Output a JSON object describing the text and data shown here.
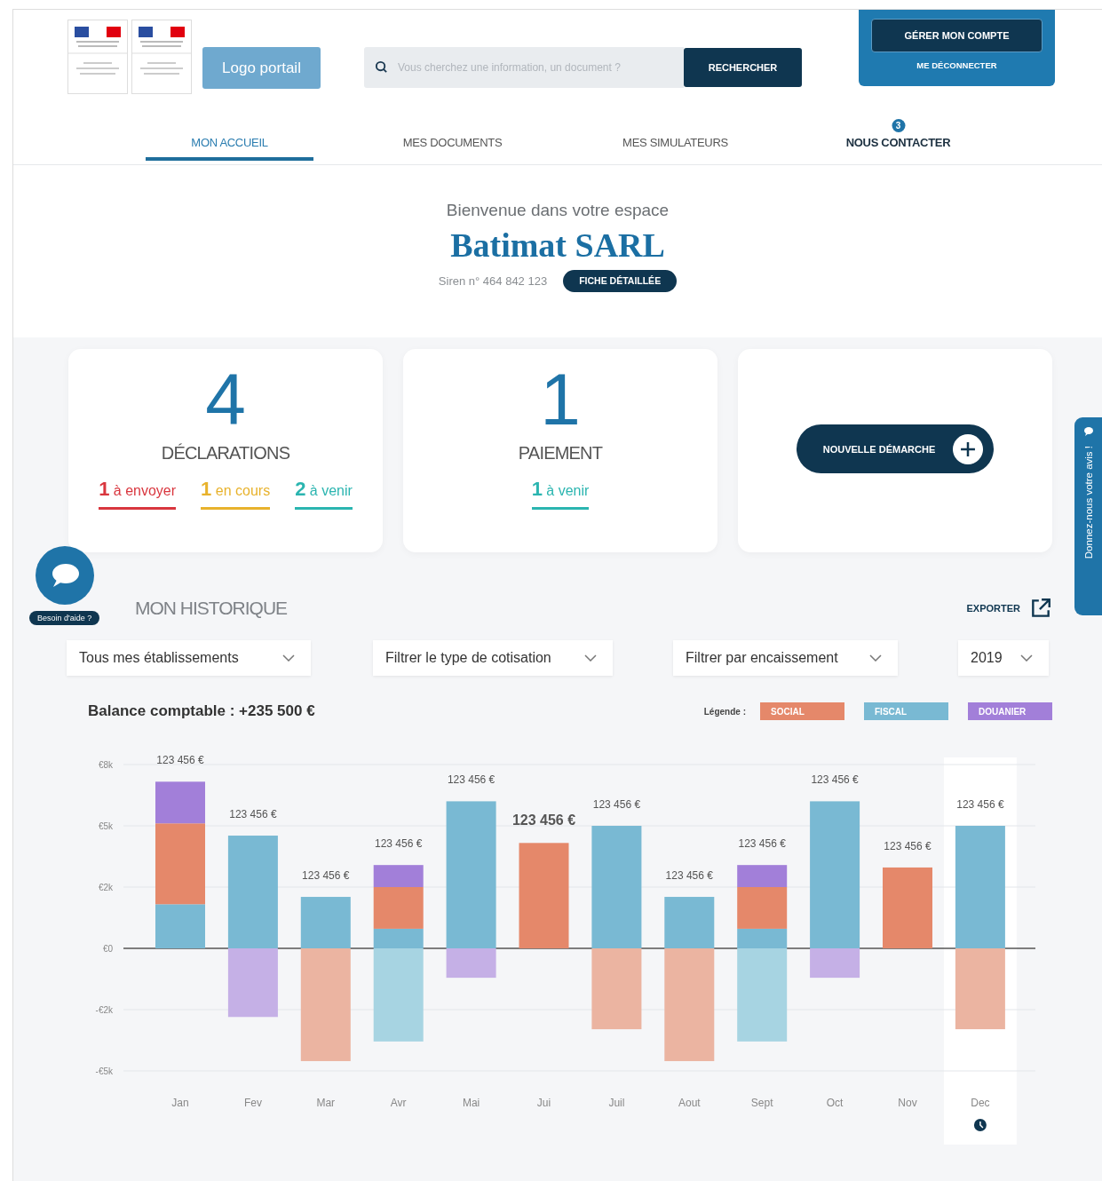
{
  "header": {
    "logo_button": "Logo portail",
    "search": {
      "placeholder": "Vous cherchez une information, un document ?",
      "button": "RECHERCHER"
    },
    "account": {
      "manage": "GÉRER MON COMPTE",
      "logout": "ME DÉCONNECTER"
    }
  },
  "nav": [
    {
      "label": "MON ACCUEIL",
      "selected": true,
      "kind": "link"
    },
    {
      "label": "MES DOCUMENTS",
      "selected": false,
      "kind": "link"
    },
    {
      "label": "MES SIMULATEURS",
      "selected": false,
      "kind": "link"
    },
    {
      "label": "NOUS CONTACTER",
      "selected": false,
      "kind": "contact",
      "badge": "3"
    }
  ],
  "welcome": {
    "greeting": "Bienvenue dans votre espace",
    "company": "Batimat SARL",
    "siren": "Siren n° 464 842 123",
    "details_button": "FICHE DÉTAILLÉE"
  },
  "summary_cards": [
    {
      "kind": "count",
      "number": "4",
      "label": "DÉCLARATIONS",
      "stats": [
        {
          "count": "1",
          "label": "à envoyer",
          "color": "#d9363e"
        },
        {
          "count": "1",
          "label": "en cours",
          "color": "#e8b22c"
        },
        {
          "count": "2",
          "label": "à venir",
          "color": "#2bb5b0"
        }
      ]
    },
    {
      "kind": "count",
      "number": "1",
      "label": "PAIEMENT",
      "stats": [
        {
          "count": "1",
          "label": "à venir",
          "color": "#2bb5b0"
        }
      ]
    },
    {
      "kind": "action",
      "button": "NOUVELLE DÉMARCHE"
    }
  ],
  "help": {
    "label": "Besoin d'aide ?"
  },
  "feedback_tab": {
    "label": "Donnez-nous votre avis !"
  },
  "history": {
    "title": "MON HISTORIQUE",
    "export": "EXPORTER",
    "filters": [
      "Tous mes établissements",
      "Filtrer le type de cotisation",
      "Filtrer par encaissement",
      "2019"
    ],
    "balance": "Balance comptable : +235 500 €",
    "legend_label": "Légende :",
    "legend": [
      {
        "label": "SOCIAL",
        "color": "#e5886a"
      },
      {
        "label": "FISCAL",
        "color": "#79b9d3"
      },
      {
        "label": "DOUANIER",
        "color": "#a27fd9"
      }
    ],
    "columns": [
      {
        "selected": false,
        "emphasized": false
      },
      {
        "selected": false,
        "emphasized": false
      },
      {
        "selected": false,
        "emphasized": false
      },
      {
        "selected": false,
        "emphasized": false
      },
      {
        "selected": false,
        "emphasized": false
      },
      {
        "selected": false,
        "emphasized": true
      },
      {
        "selected": false,
        "emphasized": false
      },
      {
        "selected": false,
        "emphasized": false
      },
      {
        "selected": false,
        "emphasized": false
      },
      {
        "selected": false,
        "emphasized": false
      },
      {
        "selected": false,
        "emphasized": false
      },
      {
        "selected": true,
        "emphasized": false
      }
    ],
    "chart_data": {
      "type": "bar",
      "stacked": true,
      "categories": [
        "Jan",
        "Fev",
        "Mar",
        "Avr",
        "Mai",
        "Jui",
        "Juil",
        "Aout",
        "Sept",
        "Oct",
        "Nov",
        "Dec"
      ],
      "ylim": [
        -5000,
        7500
      ],
      "grid": true,
      "yticks": [
        {
          "value": 7500,
          "label": "€8k"
        },
        {
          "value": 5000,
          "label": "€5k"
        },
        {
          "value": 2500,
          "label": "€2k"
        },
        {
          "value": 0,
          "label": "€0"
        },
        {
          "value": -2500,
          "label": "-€2k"
        },
        {
          "value": -5000,
          "label": "-€5k"
        }
      ],
      "series": [
        {
          "color": "#79b9d3",
          "values": [
            1800,
            4600,
            2100,
            800,
            6000,
            null,
            5000,
            2100,
            800,
            6000,
            null,
            5000
          ]
        },
        {
          "color": "#e5886a",
          "values": [
            3300,
            null,
            null,
            1700,
            null,
            4300,
            null,
            null,
            1700,
            null,
            3300,
            null
          ]
        },
        {
          "color": "#a27fd9",
          "values": [
            1700,
            null,
            null,
            900,
            null,
            null,
            null,
            null,
            900,
            null,
            null,
            null
          ]
        },
        {
          "color": "#a7d4e2",
          "values": [
            null,
            null,
            null,
            -3800,
            null,
            null,
            null,
            null,
            -3800,
            null,
            null,
            null
          ]
        },
        {
          "color": "#ebb4a1",
          "values": [
            null,
            null,
            -4600,
            null,
            null,
            null,
            -3300,
            -4600,
            null,
            null,
            null,
            -3300
          ]
        },
        {
          "color": "#c5b0e6",
          "values": [
            null,
            -2800,
            null,
            null,
            -1200,
            null,
            null,
            null,
            null,
            -1200,
            null,
            null
          ]
        }
      ],
      "value_labels": [
        "123 456 €",
        "123 456 €",
        "123 456 €",
        "123 456 €",
        "123 456 €",
        "123 456 €",
        "123 456 €",
        "123 456 €",
        "123 456 €",
        "123 456 €",
        "123 456 €",
        "123 456 €"
      ]
    }
  }
}
